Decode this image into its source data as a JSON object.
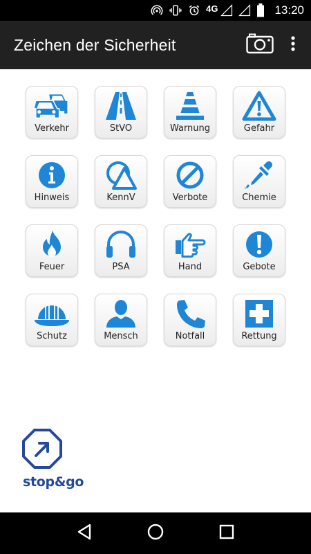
{
  "status_bar": {
    "network": "4G",
    "time": "13:20"
  },
  "app_bar": {
    "title": "Zeichen der Sicherheit"
  },
  "categories": [
    {
      "label": "Verkehr",
      "icon": "cars-icon"
    },
    {
      "label": "StVO",
      "icon": "road-icon"
    },
    {
      "label": "Warnung",
      "icon": "traffic-cone-icon"
    },
    {
      "label": "Gefahr",
      "icon": "warning-triangle-icon"
    },
    {
      "label": "Hinweis",
      "icon": "info-icon"
    },
    {
      "label": "KennV",
      "icon": "triangle-circle-icon"
    },
    {
      "label": "Verbote",
      "icon": "prohibition-icon"
    },
    {
      "label": "Chemie",
      "icon": "pipette-icon"
    },
    {
      "label": "Feuer",
      "icon": "flame-icon"
    },
    {
      "label": "PSA",
      "icon": "headphones-icon"
    },
    {
      "label": "Hand",
      "icon": "pointing-hand-icon"
    },
    {
      "label": "Gebote",
      "icon": "exclamation-circle-icon"
    },
    {
      "label": "Schutz",
      "icon": "hard-hat-icon"
    },
    {
      "label": "Mensch",
      "icon": "person-icon"
    },
    {
      "label": "Notfall",
      "icon": "phone-icon"
    },
    {
      "label": "Rettung",
      "icon": "first-aid-cross-icon"
    }
  ],
  "logo": {
    "text": "stop&go"
  },
  "colors": {
    "accent": "#1f86d6",
    "app_bar": "#212121",
    "logo": "#24499a"
  }
}
